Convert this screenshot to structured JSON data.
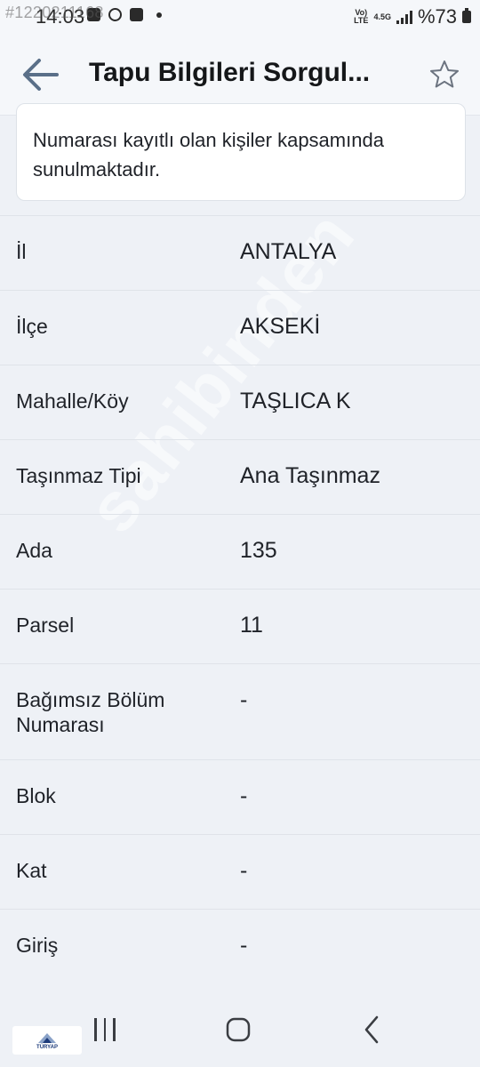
{
  "status_bar": {
    "watermark_id": "#1220211168",
    "time": "14:03",
    "network_top": "Vo)",
    "network_bottom": "LTE",
    "network_gen": "4.5G",
    "battery": "%73"
  },
  "app_bar": {
    "back_icon": "arrow-left-icon",
    "title": "Tapu Bilgileri Sorgul...",
    "favorite_icon": "star-outline-icon"
  },
  "info_card": {
    "line1": "Numarası kayıtlı olan kişiler kapsamında",
    "line2": "sunulmaktadır."
  },
  "properties": [
    {
      "label": "İl",
      "value": "ANTALYA"
    },
    {
      "label": "İlçe",
      "value": "AKSEKİ"
    },
    {
      "label": "Mahalle/Köy",
      "value": "TAŞLICA K"
    },
    {
      "label": "Taşınmaz Tipi",
      "value": "Ana Taşınmaz"
    },
    {
      "label": "Ada",
      "value": "135"
    },
    {
      "label": "Parsel",
      "value": "11"
    },
    {
      "label": "Bağımsız Bölüm Numarası",
      "value": "-"
    },
    {
      "label": "Blok",
      "value": "-"
    },
    {
      "label": "Kat",
      "value": "-"
    },
    {
      "label": "Giriş",
      "value": "-"
    }
  ],
  "watermark": "sahibinden",
  "nav_bar": {
    "recent_icon": "recent-apps-icon",
    "home_icon": "home-icon",
    "back_icon": "nav-back-icon"
  },
  "corner_logo": {
    "text": "TÜRYAP"
  },
  "colors": {
    "background": "#eef1f6",
    "card": "#ffffff",
    "text": "#1f2228",
    "divider": "#dfe3e9"
  }
}
